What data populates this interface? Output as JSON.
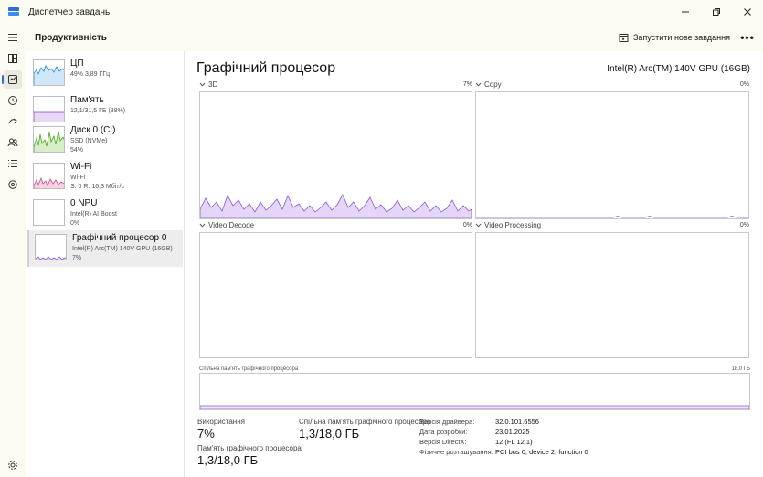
{
  "window": {
    "title": "Диспетчер завдань"
  },
  "header": {
    "section_title": "Продуктивність",
    "run_task_label": "Запустити нове завдання",
    "more_label": "•••"
  },
  "devices": [
    {
      "name": "ЦП",
      "line1": "49% 3,89 ГГц",
      "line2": ""
    },
    {
      "name": "Пам'ять",
      "line1": "12,1/31,5 ГБ (38%)",
      "line2": ""
    },
    {
      "name": "Диск 0 (C:)",
      "line1": "SSD (NVMe)",
      "line2": "54%"
    },
    {
      "name": "Wi-Fi",
      "line1": "Wi-Fi",
      "line2": "S: 0 R: 16,3 Мбіт/с"
    },
    {
      "name": "0 NPU",
      "line1": "Intel(R) AI Boost",
      "line2": "0%"
    },
    {
      "name": "Графічний процесор 0",
      "line1": "Intel(R) Arc(TM) 140V GPU (16GB)",
      "line2": "7%"
    }
  ],
  "main": {
    "title": "Графічний процесор",
    "gpu_name": "Intel(R) Arc(TM) 140V GPU (16GB)",
    "graphs": [
      {
        "label": "3D",
        "percent": "7%"
      },
      {
        "label": "Copy",
        "percent": "0%"
      },
      {
        "label": "Video Decode",
        "percent": "0%"
      },
      {
        "label": "Video Processing",
        "percent": "0%"
      }
    ],
    "shared_memory": {
      "label": "Спільна пам'ять графічного процесора",
      "max": "18,0 ГБ"
    },
    "stats": {
      "usage_label": "Використання",
      "usage_value": "7%",
      "shared_label": "Спільна пам'ять графічного процесора",
      "shared_value": "1,3/18,0 ГБ",
      "gpu_mem_label": "Пам'ять графічного процесора",
      "gpu_mem_value": "1,3/18,0 ГБ"
    },
    "info": [
      {
        "key": "Версія драйвера:",
        "value": "32.0.101.6556"
      },
      {
        "key": "Дата розробки:",
        "value": "23.01.2025"
      },
      {
        "key": "Версія DirectX:",
        "value": "12 (FL 12.1)"
      },
      {
        "key": "Фізичне розташування:",
        "value": "PCI bus 0, device 2, function 0"
      }
    ]
  },
  "colors": {
    "cpu": "#1a8fd8",
    "memory": "#8a3ccf",
    "disk": "#4aa61c",
    "wifi": "#d14781",
    "gpu": "#8e55d6",
    "accent": "#2a6fdb"
  }
}
